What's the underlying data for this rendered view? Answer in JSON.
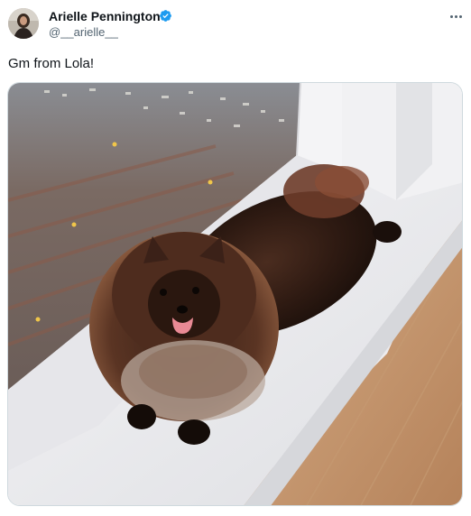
{
  "author": {
    "name": "Arielle Pennington",
    "handle": "@__arielle__",
    "verified": true,
    "verified_color": "#1d9bf0"
  },
  "post": {
    "text": "Gm from Lola!"
  },
  "icons": {
    "more": "more-horizontal-icon",
    "verified": "verified-badge-icon"
  },
  "colors": {
    "text_primary": "#0f1419",
    "text_secondary": "#536471"
  }
}
